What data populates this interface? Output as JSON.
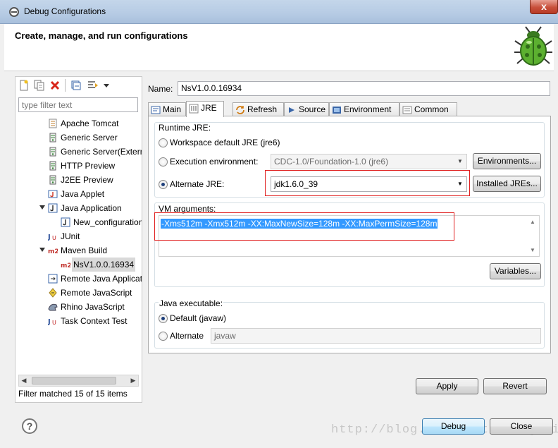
{
  "window": {
    "title": "Debug Configurations",
    "close_label": "x"
  },
  "header": {
    "title": "Create, manage, and run configurations"
  },
  "left": {
    "filter_placeholder": "type filter text",
    "tree": [
      {
        "label": "Apache Tomcat",
        "icon": "apache-tomcat-icon",
        "level": 1,
        "expand": false
      },
      {
        "label": "Generic Server",
        "icon": "server-icon",
        "level": 1,
        "expand": false
      },
      {
        "label": "Generic Server(Extern",
        "icon": "server-icon",
        "level": 1,
        "expand": false
      },
      {
        "label": "HTTP Preview",
        "icon": "server-icon",
        "level": 1,
        "expand": false
      },
      {
        "label": "J2EE Preview",
        "icon": "server-icon",
        "level": 1,
        "expand": false
      },
      {
        "label": "Java Applet",
        "icon": "java-applet-icon",
        "level": 1,
        "expand": false
      },
      {
        "label": "Java Application",
        "icon": "java-application-icon",
        "level": 1,
        "expand": true
      },
      {
        "label": "New_configuration",
        "icon": "java-config-icon",
        "level": 2,
        "expand": false
      },
      {
        "label": "JUnit",
        "icon": "junit-icon",
        "level": 1,
        "expand": false
      },
      {
        "label": "Maven Build",
        "icon": "maven-icon",
        "level": 1,
        "expand": true
      },
      {
        "label": "NsV1.0.0.16934",
        "icon": "maven-icon",
        "level": 2,
        "expand": false,
        "selected": true
      },
      {
        "label": "Remote Java Applicat",
        "icon": "remote-java-icon",
        "level": 1,
        "expand": false
      },
      {
        "label": "Remote JavaScript",
        "icon": "remote-javascript-icon",
        "level": 1,
        "expand": false
      },
      {
        "label": "Rhino JavaScript",
        "icon": "rhino-icon",
        "level": 1,
        "expand": false
      },
      {
        "label": "Task Context Test",
        "icon": "task-context-icon",
        "level": 1,
        "expand": false
      }
    ],
    "status": "Filter matched 15 of 15 items"
  },
  "right": {
    "name_label": "Name:",
    "name_value": "NsV1.0.0.16934",
    "tabs": [
      {
        "label": "Main",
        "icon": "main-tab-icon"
      },
      {
        "label": "JRE",
        "icon": "jre-tab-icon",
        "active": true
      },
      {
        "label": "Refresh",
        "icon": "refresh-tab-icon"
      },
      {
        "label": "Source",
        "icon": "source-tab-icon"
      },
      {
        "label": "Environment",
        "icon": "environment-tab-icon"
      },
      {
        "label": "Common",
        "icon": "common-tab-icon"
      }
    ],
    "runtime_jre": {
      "title": "Runtime JRE:",
      "workspace_default": "Workspace default JRE (jre6)",
      "execution_env": "Execution environment:",
      "execution_env_value": "CDC-1.0/Foundation-1.0 (jre6)",
      "environments_button": "Environments...",
      "alternate": "Alternate JRE:",
      "alternate_value": "jdk1.6.0_39",
      "installed_button": "Installed JREs..."
    },
    "vm": {
      "title": "VM arguments:",
      "value": "-Xms512m -Xmx512m -XX:MaxNewSize=128m -XX:MaxPermSize=128m",
      "variables_button": "Variables..."
    },
    "java_exec": {
      "title": "Java executable:",
      "default_label": "Default (javaw)",
      "alternate_label": "Alternate",
      "alternate_value": "javaw"
    },
    "apply_button": "Apply",
    "revert_button": "Revert"
  },
  "footer": {
    "debug_button": "Debug",
    "close_button": "Close",
    "help_glyph": "?"
  },
  "watermark": "http://blog.csdn.net/zhengnaiwen",
  "colors": {
    "selection": "#3399ff",
    "highlight_box": "#e02020"
  }
}
